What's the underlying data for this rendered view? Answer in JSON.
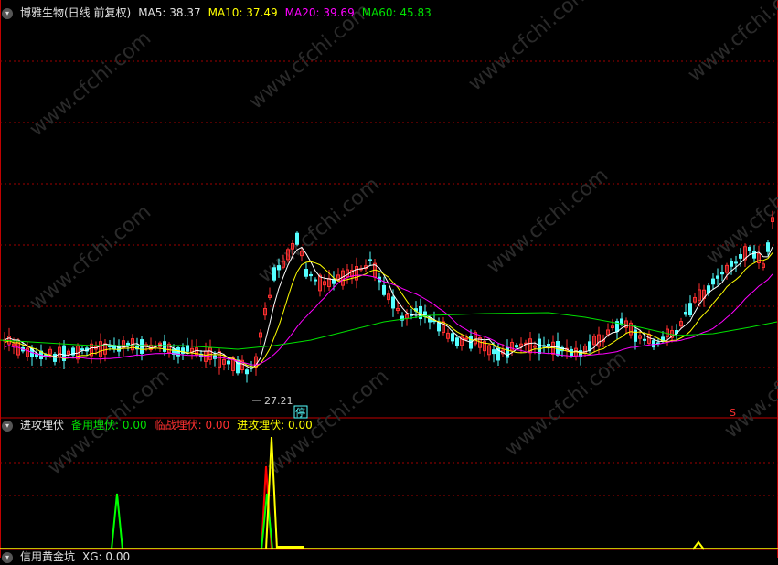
{
  "main_header": {
    "title": "博雅生物(日线 前复权)",
    "ma5_label": "MA5: 38.37",
    "ma10_label": "MA10: 37.49",
    "ma20_label": "MA20: 39.69",
    "ma60_label": "MA60: 45.83"
  },
  "indicator_header": {
    "title": "进攻埋伏",
    "l1": "备用埋伏: 0.00",
    "l2": "临战埋伏: 0.00",
    "l3": "进攻埋伏: 0.00"
  },
  "bottom_header": {
    "title": "信用黄金坑",
    "v": "XG: 0.00"
  },
  "annotations": {
    "low_price": "27.21",
    "halt_mark": "停",
    "s_mark": "S",
    "watermark": "www.cfchi.com"
  },
  "colors": {
    "up": "#ff3030",
    "down": "#54ffff",
    "ma5": "#ffffff",
    "ma10": "#ffff00",
    "ma20": "#ff00ff",
    "ma60": "#00e000",
    "grid": "#a00000",
    "spike_green": "#00ff00",
    "spike_red": "#ff0000",
    "spike_yellow": "#ffff00"
  },
  "chart_data": {
    "type": "line",
    "title": "博雅生物(日线 前复权)",
    "annotations": [
      "27.21"
    ],
    "series": [
      {
        "name": "MA5",
        "last": 38.37
      },
      {
        "name": "MA10",
        "last": 37.49
      },
      {
        "name": "MA20",
        "last": 39.69
      },
      {
        "name": "MA60",
        "last": 45.83
      }
    ],
    "indicator": {
      "name": "进攻埋伏",
      "series": [
        "备用埋伏",
        "临战埋伏",
        "进攻埋伏"
      ],
      "values": [
        0.0,
        0.0,
        0.0
      ]
    },
    "sub_indicator": {
      "name": "信用黄金坑",
      "series": [
        "XG"
      ],
      "values": [
        0.0
      ]
    }
  }
}
